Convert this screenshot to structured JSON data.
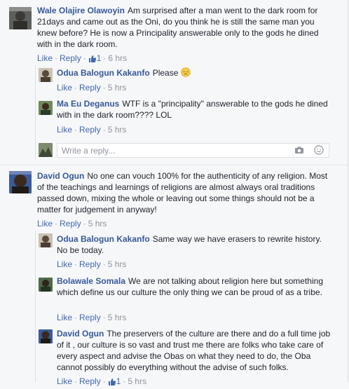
{
  "colors": {
    "link": "#365899",
    "action": "#4267b2",
    "meta": "#90949c",
    "text": "#1d2129"
  },
  "comments": [
    {
      "author": "Wale Olajire Olawoyin",
      "text": "Am surprised after a man went to the dark room for 21days and came out as the Oni, do you think he is still the same man you knew before? He is now a Principality answerable only to the gods he dined with in the dark room.",
      "like_label": "Like",
      "reply_label": "Reply",
      "like_count": "1",
      "time": "6 hrs",
      "replies": [
        {
          "author": "Odua Balogun Kakanfo",
          "text": "Please",
          "icon": "pensive-emoji-icon",
          "like_label": "Like",
          "reply_label": "Reply",
          "time": "5 hrs"
        },
        {
          "author": "Ma Eu Deganus",
          "text": "WTF is a \"principality\" answerable to the gods he dined with in the dark room???? LOL",
          "like_label": "Like",
          "reply_label": "Reply",
          "time": "5 hrs"
        }
      ],
      "reply_placeholder": "Write a reply..."
    },
    {
      "author": "David Ogun",
      "text": "No one can vouch 100% for the authenticity of any religion. Most of the teachings and learnings of religions are almost always oral traditions passed down, mixing the whole or leaving out some things should not be a matter for judgement in anyway!",
      "like_label": "Like",
      "reply_label": "Reply",
      "time": "5 hrs",
      "replies": [
        {
          "author": "Odua Balogun Kakanfo",
          "text": "Same way we have erasers to rewrite history. No be today.",
          "like_label": "Like",
          "reply_label": "Reply",
          "time": "5 hrs"
        },
        {
          "author": "Bolawale Somala",
          "text": "We are not talking about religion here but something which define us our culture the only thing we can be proud of as a tribe.",
          "like_label": "Like",
          "reply_label": "Reply",
          "time": "5 hrs"
        },
        {
          "author": "David Ogun",
          "text": "The preservers of the culture are there and do a full time job of it , our culture is so vast and trust me there are folks who take care of every aspect and advise the Obas on what they need to do, the Oba cannot possibly do everything without the advise of such folks.",
          "like_label": "Like",
          "reply_label": "Reply",
          "like_count": "1",
          "time": "5 hrs"
        }
      ]
    }
  ]
}
